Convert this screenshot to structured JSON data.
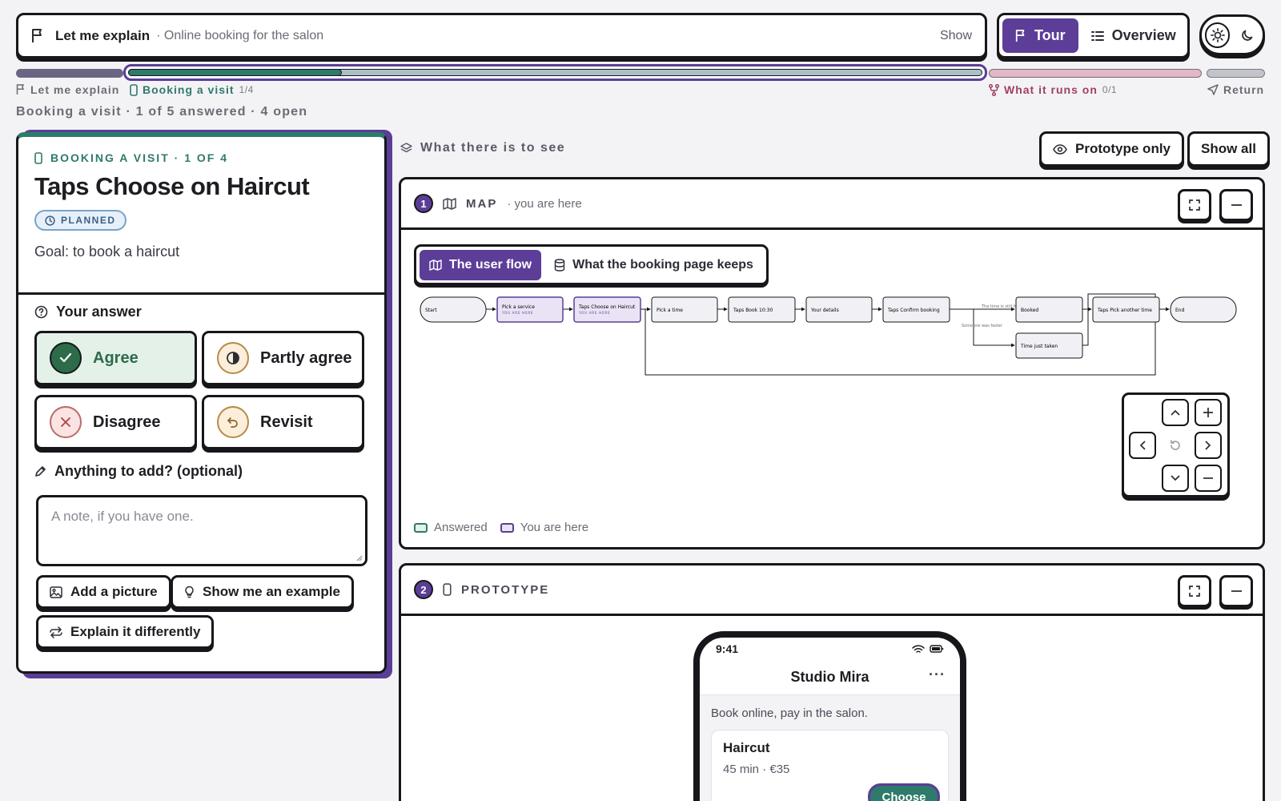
{
  "topbar": {
    "title": "Let me explain",
    "subtitle": "· Online booking for the salon",
    "show_label": "Show"
  },
  "mode": {
    "tour_label": "Tour",
    "overview_label": "Overview"
  },
  "progress": {
    "overall_fraction": 0.25,
    "crumb_explain": "Let me explain",
    "crumb_booking": "Booking a visit",
    "crumb_booking_count": "1/4",
    "crumb_runs": "What it runs on",
    "crumb_runs_count": "0/1",
    "crumb_return": "Return"
  },
  "summary": "Booking a visit · 1 of 5 answered · 4 open",
  "question": {
    "eyebrow": "BOOKING A VISIT · 1 OF 4",
    "title": "Taps Choose on Haircut",
    "status": "PLANNED",
    "goal": "Goal: to book a haircut",
    "answer_heading": "Your answer",
    "choices": {
      "agree": "Agree",
      "partly": "Partly agree",
      "disagree": "Disagree",
      "revisit": "Revisit"
    },
    "selected": "Agree",
    "note_heading": "Anything to add? (optional)",
    "note_placeholder": "A note, if you have one.",
    "add_picture": "Add a picture",
    "show_example": "Show me an example",
    "explain_differently": "Explain it differently"
  },
  "panels": {
    "heading": "What there is to see",
    "prototype_only": "Prototype only",
    "show_all": "Show all",
    "map": {
      "number": "1",
      "label": "MAP",
      "extra": "· you are here",
      "tab_flow": "The user flow",
      "tab_keeps": "What the booking page keeps",
      "legend_answered": "Answered",
      "legend_here": "You are here",
      "nodes": {
        "start": "Start",
        "pick_service": "Pick a service",
        "pick_service_tag": "YOU ARE HERE",
        "choose_haircut": "Taps Choose on Haircut",
        "choose_haircut_tag": "YOU ARE HERE",
        "pick_time": "Pick a time",
        "book_1030": "Taps Book 10:30",
        "your_details": "Your details",
        "confirm": "Taps Confirm booking",
        "booked": "Booked",
        "pick_another": "Taps Pick another time",
        "end": "End",
        "time_taken": "Time just taken",
        "edge_still_free": "The time is still free",
        "edge_faster": "Someone was faster"
      }
    },
    "prototype": {
      "number": "2",
      "label": "PROTOTYPE",
      "phone": {
        "time": "9:41",
        "app_title": "Studio Mira",
        "more": "···",
        "tagline": "Book online, pay in the salon.",
        "service_name": "Haircut",
        "service_meta": "45 min · €35",
        "choose_label": "Choose"
      }
    }
  },
  "colors": {
    "accent": "#5c3e98",
    "teal": "#2e7a6b",
    "ink": "#17171b",
    "answered_fill": "#e3f1e8",
    "rose": "#a1405e"
  }
}
